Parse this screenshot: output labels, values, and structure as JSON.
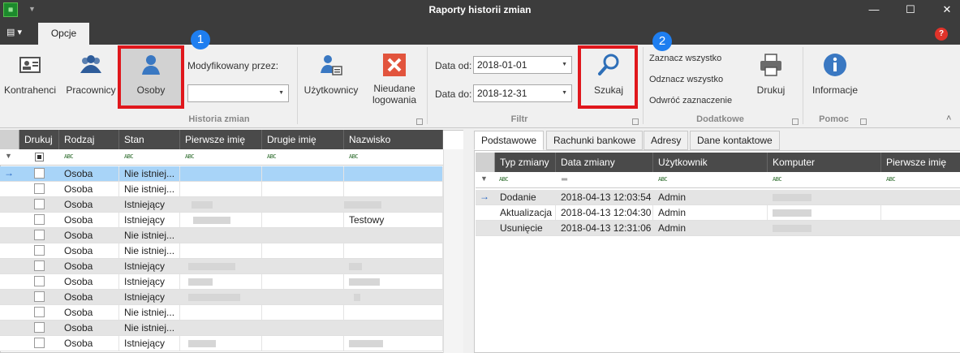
{
  "window": {
    "title": "Raporty historii zmian",
    "minimize": "—",
    "maximize": "☐",
    "close": "✕"
  },
  "ribbon_tabs": [
    "Opcje"
  ],
  "ribbon": {
    "historia_zmian": {
      "label": "Historia zmian",
      "buttons": [
        "Kontrahenci",
        "Pracownicy",
        "Osoby",
        "Użytkownicy",
        "Nieudane logowania"
      ],
      "modified_by_label": "Modyfikowany przez:",
      "modified_by_value": ""
    },
    "filtr": {
      "label": "Filtr",
      "date_from_label": "Data od:",
      "date_from": "2018-01-01",
      "date_to_label": "Data do:",
      "date_to": "2018-12-31",
      "search_button": "Szukaj"
    },
    "dodatkowe": {
      "label": "Dodatkowe",
      "select_all": "Zaznacz wszystko",
      "deselect_all": "Odznacz wszystko",
      "invert": "Odwróć zaznaczenie",
      "print": "Drukuj"
    },
    "pomoc": {
      "label": "Pomoc",
      "info": "Informacje"
    }
  },
  "badges": [
    "1",
    "2"
  ],
  "left_grid": {
    "columns": [
      "Drukuj",
      "Rodzaj",
      "Stan",
      "Pierwsze imię",
      "Drugie imię",
      "Nazwisko"
    ],
    "filter_marker": "ABC",
    "rows": [
      {
        "rodzaj": "Osoba",
        "stan": "Nie istniej...",
        "nazwisko": ""
      },
      {
        "rodzaj": "Osoba",
        "stan": "Nie istniej...",
        "nazwisko": ""
      },
      {
        "rodzaj": "Osoba",
        "stan": "Istniejący",
        "nazwisko": ""
      },
      {
        "rodzaj": "Osoba",
        "stan": "Istniejący",
        "nazwisko": "Testowy"
      },
      {
        "rodzaj": "Osoba",
        "stan": "Nie istniej...",
        "nazwisko": ""
      },
      {
        "rodzaj": "Osoba",
        "stan": "Nie istniej...",
        "nazwisko": ""
      },
      {
        "rodzaj": "Osoba",
        "stan": "Istniejący",
        "nazwisko": ""
      },
      {
        "rodzaj": "Osoba",
        "stan": "Istniejący",
        "nazwisko": ""
      },
      {
        "rodzaj": "Osoba",
        "stan": "Istniejący",
        "nazwisko": ""
      },
      {
        "rodzaj": "Osoba",
        "stan": "Nie istniej...",
        "nazwisko": ""
      },
      {
        "rodzaj": "Osoba",
        "stan": "Nie istniej...",
        "nazwisko": ""
      },
      {
        "rodzaj": "Osoba",
        "stan": "Istniejący",
        "nazwisko": ""
      }
    ]
  },
  "right_tabs": [
    "Podstawowe",
    "Rachunki bankowe",
    "Adresy",
    "Dane kontaktowe"
  ],
  "right_grid": {
    "columns": [
      "Typ zmiany",
      "Data zmiany",
      "Użytkownik",
      "Komputer",
      "Pierwsze imię"
    ],
    "rows": [
      {
        "typ": "Dodanie",
        "data": "2018-04-13 12:03:54",
        "user": "Admin"
      },
      {
        "typ": "Aktualizacja",
        "data": "2018-04-13 12:04:30",
        "user": "Admin"
      },
      {
        "typ": "Usunięcie",
        "data": "2018-04-13 12:31:06",
        "user": "Admin"
      }
    ]
  },
  "colors": {
    "accent": "#1e7ef0",
    "highlight": "#e0171c",
    "selected_row": "#a8d4f8"
  }
}
